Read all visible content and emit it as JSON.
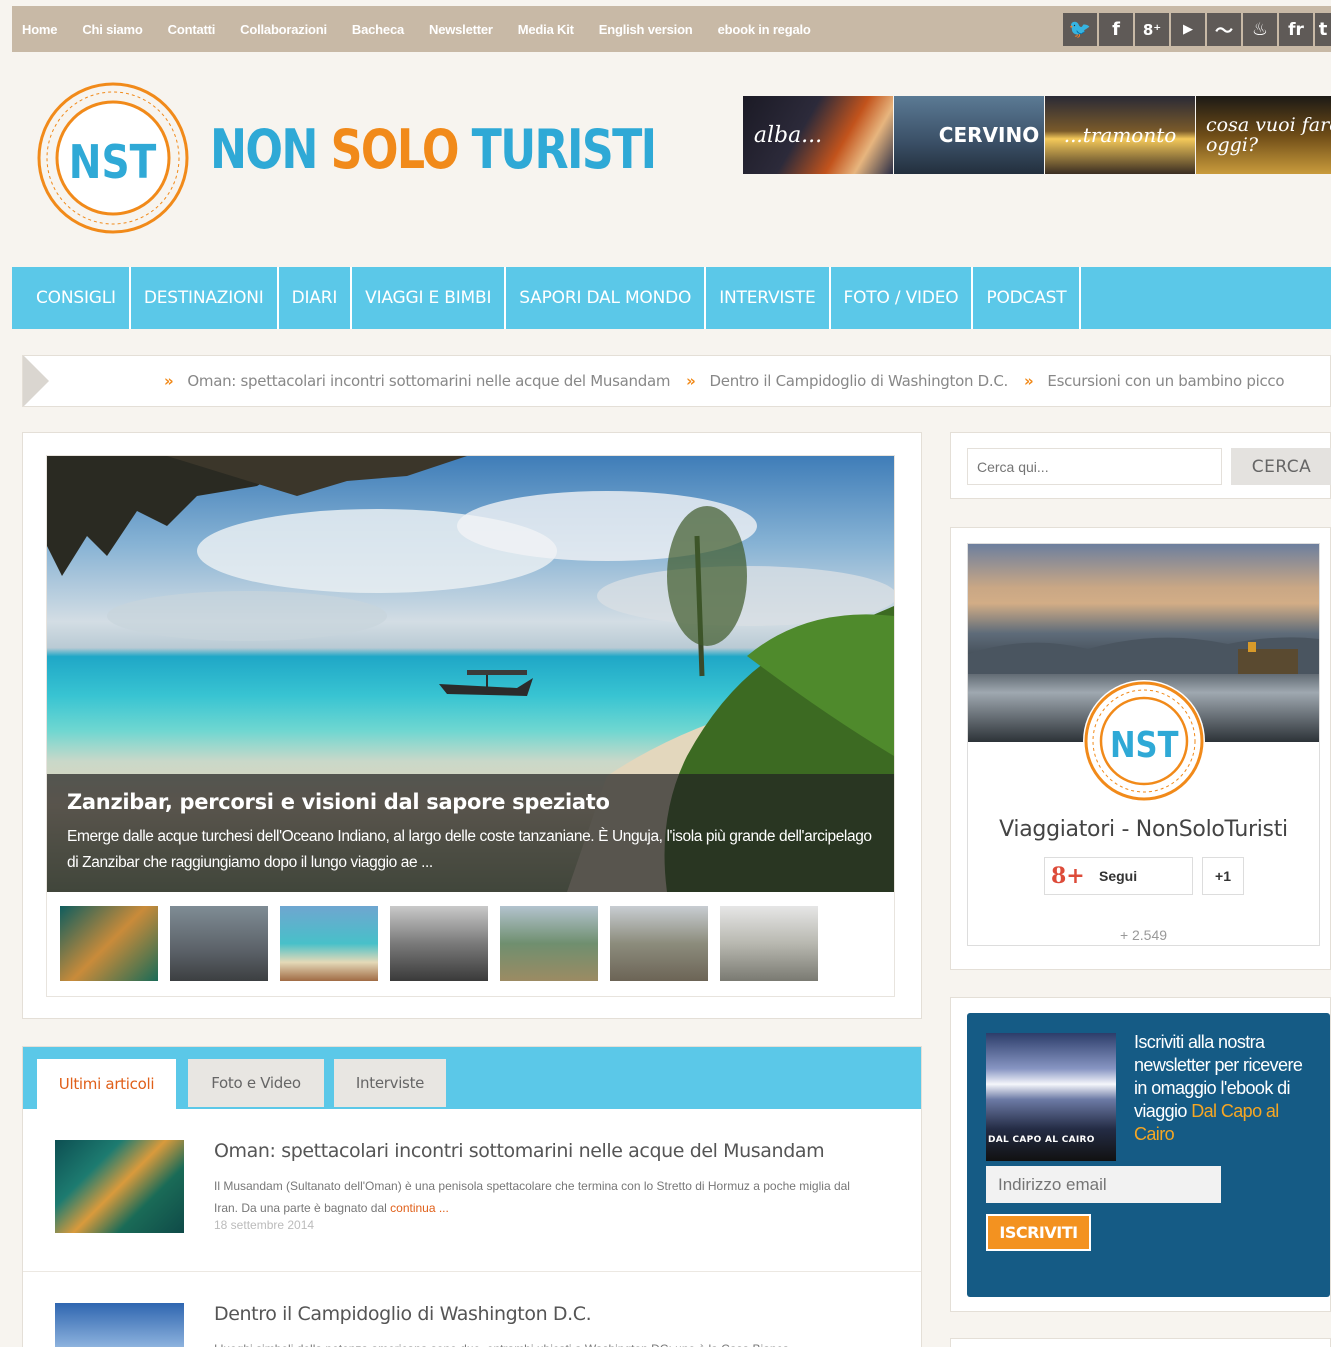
{
  "topnav": [
    "Home",
    "Chi siamo",
    "Contatti",
    "Collaborazioni",
    "Bacheca",
    "Newsletter",
    "Media Kit",
    "English version",
    "ebook in regalo"
  ],
  "social": [
    {
      "icon": "twitter-icon",
      "glyph": "🐦"
    },
    {
      "icon": "facebook-icon",
      "glyph": "f"
    },
    {
      "icon": "google-plus-icon",
      "glyph": "8⁺"
    },
    {
      "icon": "youtube-icon",
      "glyph": "▶"
    },
    {
      "icon": "rss-icon",
      "glyph": "〜"
    },
    {
      "icon": "flame-icon",
      "glyph": "♨"
    },
    {
      "icon": "flag-fr-icon",
      "glyph": "fr"
    },
    {
      "icon": "more-icon",
      "glyph": "t"
    }
  ],
  "brand": {
    "logo": "NST",
    "part1": "NON ",
    "part2": "SOLO ",
    "part3": "TURISTI"
  },
  "banner": [
    "alba...",
    "CERVINO",
    "...tramonto",
    "cosa vuoi fare oggi?"
  ],
  "mainnav": [
    "CONSIGLI",
    "DESTINAZIONI",
    "DIARI",
    "VIAGGI E BIMBI",
    "SAPORI DAL MONDO",
    "INTERVISTE",
    "FOTO / VIDEO",
    "PODCAST"
  ],
  "ticker": [
    "Oman: spettacolari incontri sottomarini nelle acque del Musandam",
    "Dentro il Campidoglio di Washington D.C.",
    "Escursioni con un bambino picco"
  ],
  "ticker_separator": "»",
  "featured": {
    "title": "Zanzibar, percorsi e visioni dal sapore speziato",
    "excerpt": "Emerge dalle acque turchesi dell'Oceano Indiano, al largo delle coste tanzaniane. È Unguja, l'isola più grande dell'arcipelago di Zanzibar che raggiungiamo dopo il lungo viaggio ae ..."
  },
  "tabs": [
    "Ultimi articoli",
    "Foto e Video",
    "Interviste"
  ],
  "posts": [
    {
      "title": "Oman: spettacolari incontri sottomarini nelle acque del Musandam",
      "excerpt": "Il Musandam (Sultanato dell'Oman) è una penisola spettacolare che termina con lo Stretto di Hormuz a poche miglia dal Iran. Da una parte è bagnato dal",
      "more": "continua ...",
      "date": "18 settembre 2014"
    },
    {
      "title": "Dentro il Campidoglio di Washington D.C.",
      "excerpt": "I luoghi simboli della potenza americana sono due, entrambi ubicati a Washington DC: uno è la Casa Bianca"
    }
  ],
  "search": {
    "placeholder": "Cerca qui...",
    "button": "CERCA"
  },
  "gplus": {
    "logo": "NST",
    "name": "Viaggiatori - NonSoloTuristi",
    "follow": "Segui",
    "plus_one": "+1",
    "count": "+ 2.549",
    "icon": "8+"
  },
  "newsletter": {
    "text": "Iscriviti alla nostra newsletter per ricevere in omaggio l'ebook di viaggio",
    "highlight": "Dal Capo al Cairo",
    "image_caption": "DAL CAPO AL CAIRO",
    "email_placeholder": "Indirizzo email",
    "button": "ISCRIVITI"
  },
  "colors": {
    "accent": "#5bc8e8",
    "orange": "#f18a1a",
    "topbar": "#c8b9a6",
    "newsletter_bg": "#155b85"
  }
}
